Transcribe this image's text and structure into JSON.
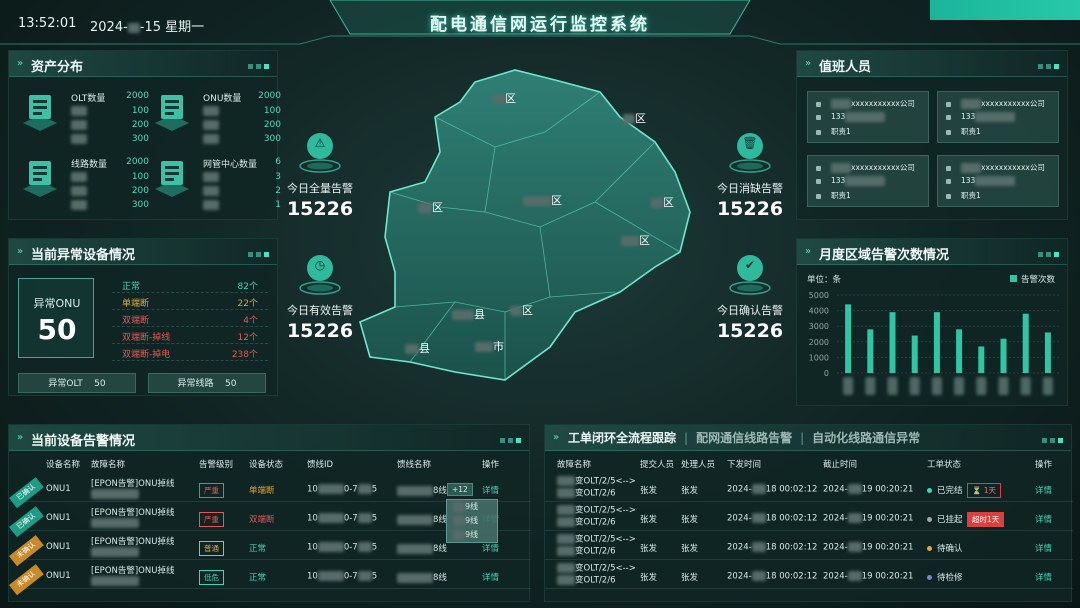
{
  "header": {
    "time": "13:52:01",
    "date_prefix": "2024-",
    "date_suffix": "-15 星期一",
    "title": "配电通信网运行监控系统"
  },
  "assets": {
    "title": "资产分布",
    "groups": [
      {
        "label": "OLT数量",
        "total": "2000",
        "rows": [
          "100",
          "200",
          "300"
        ],
        "icon": "server-icon"
      },
      {
        "label": "ONU数量",
        "total": "2000",
        "rows": [
          "100",
          "200",
          "300"
        ],
        "icon": "device-icon"
      },
      {
        "label": "线路数量",
        "total": "2000",
        "rows": [
          "100",
          "200",
          "300"
        ],
        "icon": "line-icon"
      },
      {
        "label": "网管中心数量",
        "total": "6",
        "rows": [
          "3",
          "2",
          "1"
        ],
        "icon": "cube-icon"
      }
    ]
  },
  "abnormal": {
    "title": "当前异常设备情况",
    "onu_label": "异常ONU",
    "onu_value": "50",
    "status": [
      {
        "name": "正常",
        "count": "82个",
        "color": "#3fd6b5"
      },
      {
        "name": "单端断",
        "count": "22个",
        "color": "#e0a93a"
      },
      {
        "name": "双端断",
        "count": "4个",
        "color": "#e25a55"
      },
      {
        "name": "双端断-掉线",
        "count": "12个",
        "color": "#e25a55"
      },
      {
        "name": "双端断-掉电",
        "count": "238个",
        "color": "#e25a55"
      }
    ],
    "olt_label": "异常OLT",
    "olt_value": "50",
    "line_label": "异常线路",
    "line_value": "50"
  },
  "kpis": [
    {
      "label": "今日全量告警",
      "value": "15226",
      "icon": "alarm-icon"
    },
    {
      "label": "今日消缺告警",
      "value": "15226",
      "icon": "trash-icon"
    },
    {
      "label": "今日有效告警",
      "value": "15226",
      "icon": "clock-icon"
    },
    {
      "label": "今日确认告警",
      "value": "15226",
      "icon": "check-icon"
    }
  ],
  "map": {
    "labels": [
      "区",
      "区",
      "区",
      "区",
      "区",
      "区",
      "区",
      "县",
      "县",
      "市"
    ]
  },
  "duty": {
    "title": "值班人员",
    "cards": [
      {
        "company": "xxxxxxxxxxx公司",
        "phone": "133",
        "role": "职责1"
      },
      {
        "company": "xxxxxxxxxxx公司",
        "phone": "133",
        "role": "职责1"
      },
      {
        "company": "xxxxxxxxxxx公司",
        "phone": "133",
        "role": "职责1"
      },
      {
        "company": "xxxxxxxxxxx公司",
        "phone": "133",
        "role": "职责1"
      }
    ]
  },
  "monthly": {
    "title": "月度区域告警次数情况",
    "unit": "单位：条",
    "legend": "告警次数"
  },
  "chart_data": {
    "type": "bar",
    "title": "月度区域告警次数情况",
    "ylabel": "单位：条",
    "ylim": [
      0,
      5000
    ],
    "yticks": [
      "5000",
      "4000",
      "3000",
      "2000",
      "1000",
      "0"
    ],
    "series": [
      {
        "name": "告警次数",
        "values": [
          4400,
          2800,
          3900,
          2400,
          3900,
          2800,
          1700,
          2200,
          3800,
          2600
        ]
      }
    ],
    "legend": "top-right",
    "color": "#2fc6a6"
  },
  "alarms": {
    "title": "当前设备告警情况",
    "headers": [
      "设备名称",
      "故障名称",
      "告警级别",
      "设备状态",
      "馈线ID",
      "馈线名称",
      "操作"
    ],
    "rows": [
      {
        "ribbon": "已确认",
        "ribbon_color": "#1f9c86",
        "device": "ONU1",
        "fault": "[EPON告警]ONU掉线",
        "level": "严重",
        "level_color": "#e25a55",
        "status": "单端断",
        "status_color": "#e0a93a",
        "feeder_id_a": "10",
        "feeder_id_b": "0-7",
        "feeder_id_c": "5",
        "feeder_name": "8线",
        "op": "详情",
        "badge": "+12"
      },
      {
        "ribbon": "已确认",
        "ribbon_color": "#1f9c86",
        "device": "ONU1",
        "fault": "[EPON告警]ONU掉线",
        "level": "严重",
        "level_color": "#e25a55",
        "status": "双端断",
        "status_color": "#e25a55",
        "feeder_id_a": "10",
        "feeder_id_b": "0-7",
        "feeder_id_c": "5",
        "feeder_name": "8线",
        "op": "详情"
      },
      {
        "ribbon": "未确认",
        "ribbon_color": "#c98a2a",
        "device": "ONU1",
        "fault": "[EPON告警]ONU掉线",
        "level": "普通",
        "level_color": "#e0a93a",
        "status": "正常",
        "status_color": "#3fd6b5",
        "feeder_id_a": "10",
        "feeder_id_b": "0-7",
        "feeder_id_c": "5",
        "feeder_name": "8线",
        "op": "详情"
      },
      {
        "ribbon": "未确认",
        "ribbon_color": "#c98a2a",
        "device": "ONU1",
        "fault": "[EPON告警]ONU掉线",
        "level": "低危",
        "level_color": "#3fd6b5",
        "status": "正常",
        "status_color": "#3fd6b5",
        "feeder_id_a": "10",
        "feeder_id_b": "0-7",
        "feeder_id_c": "5",
        "feeder_name": "8线",
        "op": "详情"
      }
    ],
    "popup": [
      "9线",
      "9线",
      "9线"
    ]
  },
  "workorders": {
    "tabs": [
      "工单闭环全流程跟踪",
      "配网通信线路告警",
      "自动化线路通信异常"
    ],
    "separator": "|",
    "headers": [
      "故障名称",
      "提交人员",
      "处理人员",
      "下发时间",
      "截止时间",
      "工单状态",
      "操作"
    ],
    "rows": [
      {
        "fault1": "变OLT/2/5<-->",
        "fault2": "变OLT/2/6",
        "submitter": "张发",
        "handler": "张发",
        "issued_a": "2024-",
        "issued_b": "18 00:02:12",
        "due_a": "2024-",
        "due_b": "19 00:20:21",
        "state": "已完结",
        "state_color": "#3fd6b5",
        "flag": "⏳ 1天",
        "flag_style": "outline",
        "op": "详情"
      },
      {
        "fault1": "变OLT/2/5<-->",
        "fault2": "变OLT/2/6",
        "submitter": "张发",
        "handler": "张发",
        "issued_a": "2024-",
        "issued_b": "18 00:02:12",
        "due_a": "2024-",
        "due_b": "19 00:20:21",
        "state": "已挂起",
        "state_color": "#9aa9a6",
        "flag": "超时1天",
        "flag_style": "solid",
        "op": "详情"
      },
      {
        "fault1": "变OLT/2/5<-->",
        "fault2": "变OLT/2/6",
        "submitter": "张发",
        "handler": "张发",
        "issued_a": "2024-",
        "issued_b": "18 00:02:12",
        "due_a": "2024-",
        "due_b": "19 00:20:21",
        "state": "待确认",
        "state_color": "#e0a93a",
        "flag": "",
        "op": "详情"
      },
      {
        "fault1": "变OLT/2/5<-->",
        "fault2": "变OLT/2/6",
        "submitter": "张发",
        "handler": "张发",
        "issued_a": "2024-",
        "issued_b": "18 00:02:12",
        "due_a": "2024-",
        "due_b": "19 00:20:21",
        "state": "待检修",
        "state_color": "#7b7fd6",
        "flag": "",
        "op": "详情"
      }
    ]
  }
}
